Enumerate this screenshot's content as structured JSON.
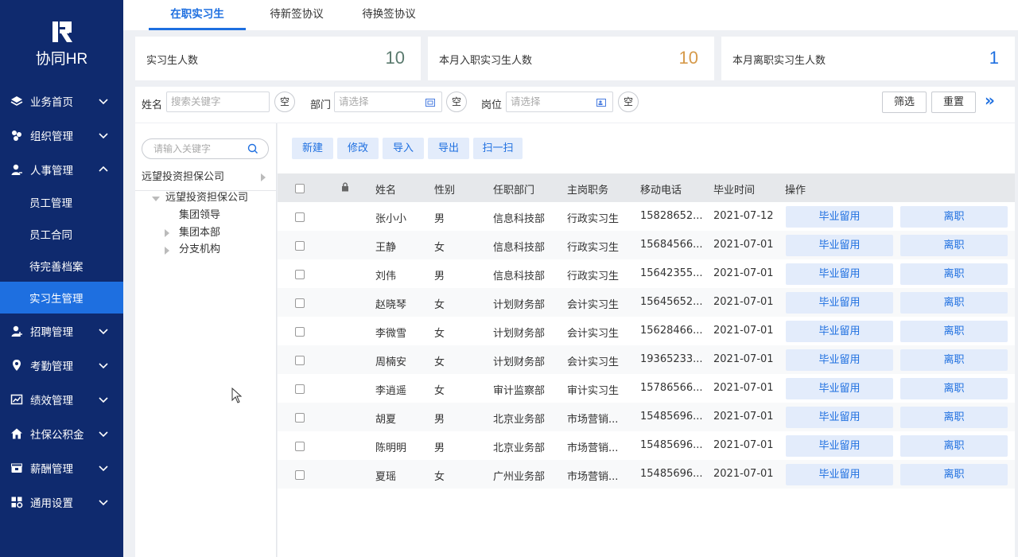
{
  "brand": {
    "name": "协同HR"
  },
  "sidebar": {
    "items": [
      {
        "label": "业务首页",
        "icon": "layers-icon"
      },
      {
        "label": "组织管理",
        "icon": "org-icon"
      },
      {
        "label": "人事管理",
        "icon": "person-icon",
        "expanded": true
      },
      {
        "label": "招聘管理",
        "icon": "recruit-icon"
      },
      {
        "label": "考勤管理",
        "icon": "location-pin-icon"
      },
      {
        "label": "绩效管理",
        "icon": "chart-icon"
      },
      {
        "label": "社保公积金",
        "icon": "house-icon"
      },
      {
        "label": "薪酬管理",
        "icon": "wallet-icon"
      },
      {
        "label": "通用设置",
        "icon": "settings-grid-icon"
      }
    ],
    "sub_items": [
      "员工管理",
      "员工合同",
      "待完善档案",
      "实习生管理"
    ],
    "active_sub": "实习生管理"
  },
  "tabs": [
    "在职实习生",
    "待新签协议",
    "待换签协议"
  ],
  "active_tab": "在职实习生",
  "stats": [
    {
      "label": "实习生人数",
      "value": "10",
      "color": "#5a7a6e"
    },
    {
      "label": "本月入职实习生人数",
      "value": "10",
      "color": "#d69a4a"
    },
    {
      "label": "本月离职实习生人数",
      "value": "1",
      "color": "#1e6fe0"
    }
  ],
  "filters": {
    "name_label": "姓名",
    "name_placeholder": "搜索关键字",
    "dept_label": "部门",
    "dept_placeholder": "请选择",
    "post_label": "岗位",
    "post_placeholder": "请选择",
    "clear_label": "空",
    "filter_button": "筛选",
    "reset_button": "重置",
    "expand_icon": "»"
  },
  "tree": {
    "search_placeholder": "请输入关键字",
    "root": "远望投资担保公司",
    "child": "远望投资担保公司",
    "nodes": [
      "集团领导",
      "集团本部",
      "分支机构"
    ]
  },
  "actions": [
    "新建",
    "修改",
    "导入",
    "导出",
    "扫一扫"
  ],
  "table": {
    "columns": [
      "姓名",
      "性别",
      "任职部门",
      "主岗职务",
      "移动电话",
      "毕业时间",
      "操作"
    ],
    "rows": [
      {
        "name": "张小小",
        "gender": "男",
        "dept": "信息科技部",
        "post": "行政实习生",
        "phone": "15828652...",
        "grad": "2021-07-12"
      },
      {
        "name": "王静",
        "gender": "女",
        "dept": "信息科技部",
        "post": "行政实习生",
        "phone": "15684566...",
        "grad": "2021-07-01"
      },
      {
        "name": "刘伟",
        "gender": "男",
        "dept": "信息科技部",
        "post": "行政实习生",
        "phone": "15642355...",
        "grad": "2021-07-01"
      },
      {
        "name": "赵晓琴",
        "gender": "女",
        "dept": "计划财务部",
        "post": "会计实习生",
        "phone": "15645652...",
        "grad": "2021-07-01"
      },
      {
        "name": "李微雪",
        "gender": "女",
        "dept": "计划财务部",
        "post": "会计实习生",
        "phone": "15628466...",
        "grad": "2021-07-01"
      },
      {
        "name": "周楠安",
        "gender": "女",
        "dept": "计划财务部",
        "post": "会计实习生",
        "phone": "19365233...",
        "grad": "2021-07-01"
      },
      {
        "name": "李逍遥",
        "gender": "女",
        "dept": "审计监察部",
        "post": "审计实习生",
        "phone": "15786566...",
        "grad": "2021-07-01"
      },
      {
        "name": "胡夏",
        "gender": "男",
        "dept": "北京业务部",
        "post": "市场营销...",
        "phone": "15485696...",
        "grad": "2021-07-01"
      },
      {
        "name": "陈明明",
        "gender": "男",
        "dept": "北京业务部",
        "post": "市场营销...",
        "phone": "15485696...",
        "grad": "2021-07-01"
      },
      {
        "name": "夏瑶",
        "gender": "女",
        "dept": "广州业务部",
        "post": "市场营销...",
        "phone": "15485696...",
        "grad": "2021-07-01"
      }
    ],
    "op_graduate": "毕业留用",
    "op_leave": "离职"
  },
  "colors": {
    "sidebar_bg": "#0f2a6e",
    "accent": "#1e6fe0",
    "button_bg": "#e3ecfb"
  }
}
